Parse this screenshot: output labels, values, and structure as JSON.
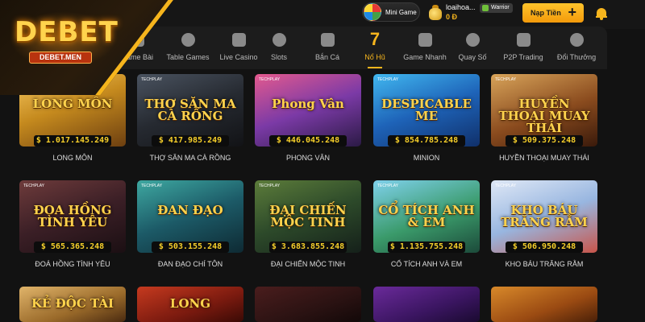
{
  "brand": {
    "logo_main": "DEBET",
    "logo_sub": "DEBET.MEN"
  },
  "header": {
    "mini_game_label": "Mini Game",
    "username": "loaihoa...",
    "balance": "0 Đ",
    "rank_badge": "Warrior",
    "deposit_label": "Nạp Tiền",
    "deposit_plus": "+"
  },
  "categories": [
    {
      "label": "Game Bài",
      "icon": "cards-icon"
    },
    {
      "label": "Table Games",
      "icon": "chips-icon"
    },
    {
      "label": "Live Casino",
      "icon": "diamond-icon"
    },
    {
      "label": "Slots",
      "icon": "cherry-icon"
    },
    {
      "label": "Bắn Cá",
      "icon": "fish-icon"
    },
    {
      "label": "Nổ Hũ",
      "icon": "seven-icon",
      "number": "7",
      "active": true
    },
    {
      "label": "Game Nhanh",
      "icon": "lightning-icon"
    },
    {
      "label": "Quay Số",
      "icon": "lottery-balls-icon"
    },
    {
      "label": "P2P Trading",
      "icon": "p2p-icon"
    },
    {
      "label": "Đổi Thưởng",
      "icon": "money-bag-icon"
    }
  ],
  "provider_label": "TECHPLAY",
  "games": [
    {
      "title": "LONG MÔN",
      "thumb_text": "LONG MÔN",
      "jackpot": "$ 1.017.145.249"
    },
    {
      "title": "THỢ SĂN MA CÀ RỒNG",
      "thumb_text": "THỢ SĂN MA CÀ RỒNG",
      "jackpot": "$ 417.985.249"
    },
    {
      "title": "PHONG VÂN",
      "thumb_text": "Phong Vân",
      "jackpot": "$ 446.045.248"
    },
    {
      "title": "MINION",
      "thumb_text": "DESPICABLE ME",
      "jackpot": "$ 854.785.248"
    },
    {
      "title": "HUYỀN THOẠI MUAY THÁI",
      "thumb_text": "HUYỀN THOẠI MUAY THÁI",
      "jackpot": "$ 509.375.248"
    },
    {
      "title": "ĐOÁ HỒNG TÌNH YÊU",
      "thumb_text": "ĐOA HỒNG TÌNH YÊU",
      "jackpot": "$ 565.365.248"
    },
    {
      "title": "ĐAN ĐẠO CHÍ TÔN",
      "thumb_text": "ĐAN ĐẠO",
      "jackpot": "$ 503.155.248"
    },
    {
      "title": "ĐẠI CHIẾN MỘC TINH",
      "thumb_text": "ĐẠI CHIẾN MỘC TINH",
      "jackpot": "$ 3.683.855.248"
    },
    {
      "title": "CỔ TÍCH ANH VÀ EM",
      "thumb_text": "CỔ TÍCH ANH & EM",
      "jackpot": "$ 1.135.755.248"
    },
    {
      "title": "KHO BÁU TRĂNG RẰM",
      "thumb_text": "KHO BÁU TRĂNG RẰM",
      "jackpot": "$ 506.950.248"
    },
    {
      "title": "",
      "thumb_text": "KẺ ĐỘC TÀI",
      "jackpot": ""
    },
    {
      "title": "",
      "thumb_text": "LONG",
      "jackpot": ""
    },
    {
      "title": "",
      "thumb_text": "",
      "jackpot": ""
    },
    {
      "title": "",
      "thumb_text": "",
      "jackpot": ""
    },
    {
      "title": "",
      "thumb_text": "",
      "jackpot": ""
    }
  ],
  "colors": {
    "accent": "#f6b51d",
    "background": "#121212",
    "nav": "#1c1c1c"
  }
}
